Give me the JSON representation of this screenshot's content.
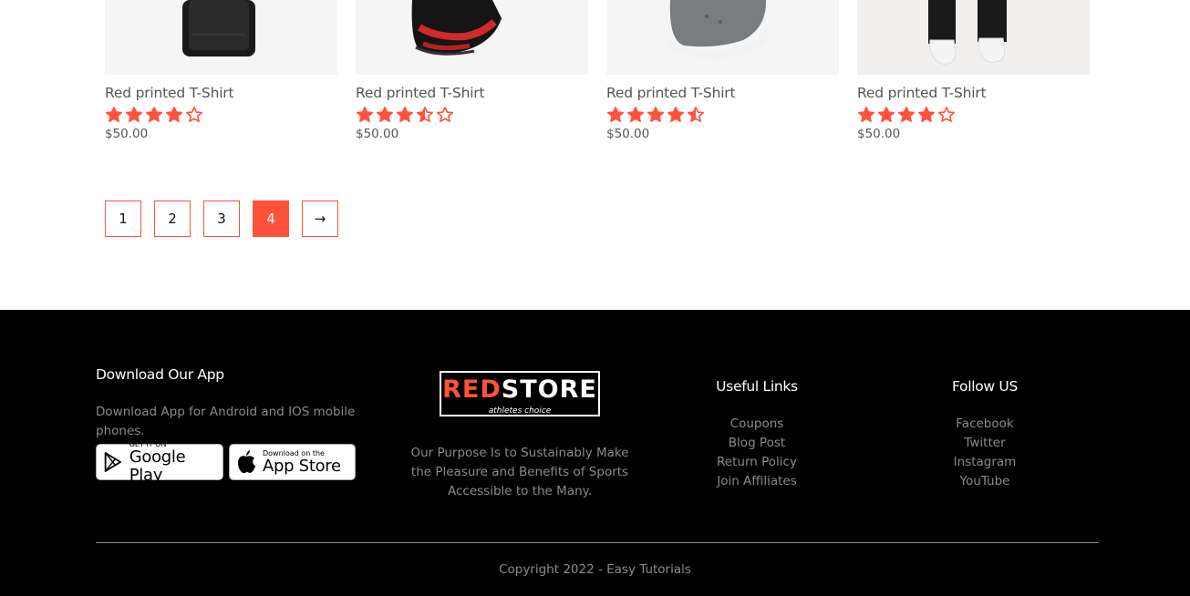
{
  "products": [
    {
      "title": "Red printed T-Shirt",
      "rating": 4,
      "price": "$50.00",
      "image": "smartwatch-band"
    },
    {
      "title": "Red printed T-Shirt",
      "rating": 3.5,
      "price": "$50.00",
      "image": "black-red-sneaker"
    },
    {
      "title": "Red printed T-Shirt",
      "rating": 4.5,
      "price": "$50.00",
      "image": "grey-sneaker"
    },
    {
      "title": "Red printed T-Shirt",
      "rating": 4,
      "price": "$50.00",
      "image": "white-shoes-on-model"
    }
  ],
  "pagination": {
    "pages": [
      "1",
      "2",
      "3",
      "4"
    ],
    "active": "4",
    "next": "→"
  },
  "footer": {
    "app": {
      "title": "Download Our App",
      "description": "Download App for Android and IOS mobile phones.",
      "google_play": {
        "small": "GET IT ON",
        "big": "Google Play"
      },
      "app_store": {
        "small": "Download on the",
        "big": "App Store"
      }
    },
    "logo": {
      "red_part": "RED",
      "white_part": "STORE",
      "tagline": "athletes choice"
    },
    "purpose": "Our Purpose Is to Sustainably Make the Pleasure and Benefits of Sports Accessible to the Many.",
    "useful_links": {
      "title": "Useful Links",
      "items": [
        "Coupons",
        "Blog Post",
        "Return Policy",
        "Join Affiliates"
      ]
    },
    "follow": {
      "title": "Follow US",
      "items": [
        "Facebook",
        "Twitter",
        "Instagram",
        "YouTube"
      ]
    },
    "copyright": "Copyright 2022 - Easy Tutorials"
  },
  "colors": {
    "accent": "#ff523b",
    "footer_bg": "#000000",
    "text": "#555555",
    "muted": "#8a8a8a"
  }
}
